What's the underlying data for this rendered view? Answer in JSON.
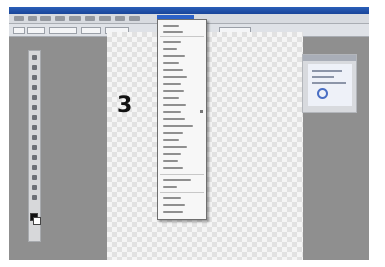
{
  "canvas": {
    "step_number": "3"
  },
  "colors": {
    "title_bar": "#1f4fa8",
    "menu_highlight": "#2d62c8",
    "workspace": "#8f8f8f",
    "canvas_checker": "#e2e2e2",
    "dropdown_bg": "#f7f7f7"
  },
  "icons": {
    "menu_submenu_arrow": "triangle-right-icon",
    "panel_marker": "circle-marker-icon"
  }
}
